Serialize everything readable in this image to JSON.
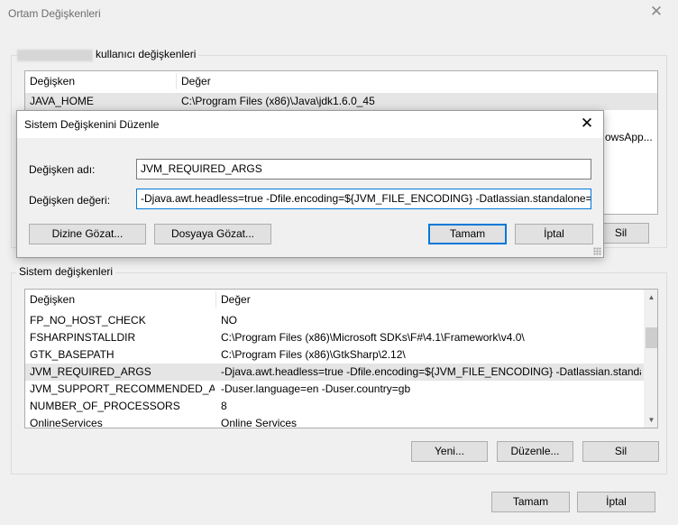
{
  "window": {
    "title": "Ortam Değişkenleri",
    "close_glyph": "✕"
  },
  "user_vars": {
    "label": "kullanıcı değişkenleri",
    "headers": {
      "name": "Değişken",
      "value": "Değer"
    },
    "rows": [
      {
        "name": "JAVA_HOME",
        "value": "C:\\Program Files (x86)\\Java\\jdk1.6.0_45"
      }
    ],
    "partial_text": "owsApp...",
    "delete_label": "Sil"
  },
  "dialog": {
    "title": "Sistem Değişkenini Düzenle",
    "close_glyph": "✕",
    "name_label": "Değişken adı:",
    "name_value": "JVM_REQUIRED_ARGS",
    "value_label": "Değişken değeri:",
    "value_value": "-Djava.awt.headless=true -Dfile.encoding=${JVM_FILE_ENCODING} -Datlassian.standalone=BIT",
    "browse_dir_label": "Dizine Gözat...",
    "browse_file_label": "Dosyaya Gözat...",
    "ok_label": "Tamam",
    "cancel_label": "İptal"
  },
  "system_vars": {
    "label": "Sistem değişkenleri",
    "headers": {
      "name": "Değişken",
      "value": "Değer"
    },
    "rows": [
      {
        "name": "FP_NO_HOST_CHECK",
        "value": "NO"
      },
      {
        "name": "FSHARPINSTALLDIR",
        "value": "C:\\Program Files (x86)\\Microsoft SDKs\\F#\\4.1\\Framework\\v4.0\\"
      },
      {
        "name": "GTK_BASEPATH",
        "value": "C:\\Program Files (x86)\\GtkSharp\\2.12\\"
      },
      {
        "name": "JVM_REQUIRED_ARGS",
        "value": "-Djava.awt.headless=true -Dfile.encoding=${JVM_FILE_ENCODING} -Datlassian.standa..."
      },
      {
        "name": "JVM_SUPPORT_RECOMMENDED_AR",
        "value": "-Duser.language=en -Duser.country=gb"
      },
      {
        "name": "NUMBER_OF_PROCESSORS",
        "value": "8"
      },
      {
        "name": "OnlineServices",
        "value": "Online Services"
      }
    ],
    "selected_row": "JVM_REQUIRED_ARGS",
    "new_label": "Yeni...",
    "edit_label": "Düzenle...",
    "delete_label": "Sil"
  },
  "footer": {
    "ok_label": "Tamam",
    "cancel_label": "İptal"
  }
}
